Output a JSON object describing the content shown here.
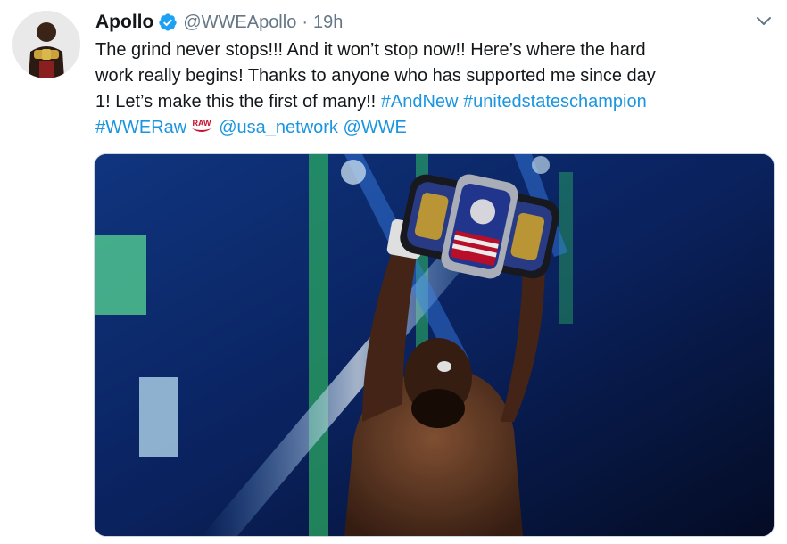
{
  "author": {
    "display_name": "Apollo",
    "handle": "@WWEApollo",
    "separator": "·",
    "time": "19h",
    "verified": true,
    "avatar_icon": "avatar-photo-champion"
  },
  "tweet": {
    "text_line1": "The grind never stops!!! And it won’t stop now!! Here’s where the hard",
    "text_line2": "work really begins! Thanks to anyone who has supported me since day",
    "text_line3_plain": "1! Let’s make this the first of many!! ",
    "hashtag_andnew": "#AndNew",
    "hashtag_champion": "#unitedstateschampion",
    "hashtag_wweraw": "#WWERaw",
    "raw_emoji_icon": "raw-logo-emoji",
    "mention_usa": "@usa_network",
    "mention_wwe": "@WWE"
  },
  "media": {
    "description_icon": "photo-wrestler-holding-championship-belt"
  },
  "colors": {
    "link": "#1b95e0",
    "text": "#14171a",
    "secondary": "#657786",
    "verified": "#1da1f2"
  }
}
